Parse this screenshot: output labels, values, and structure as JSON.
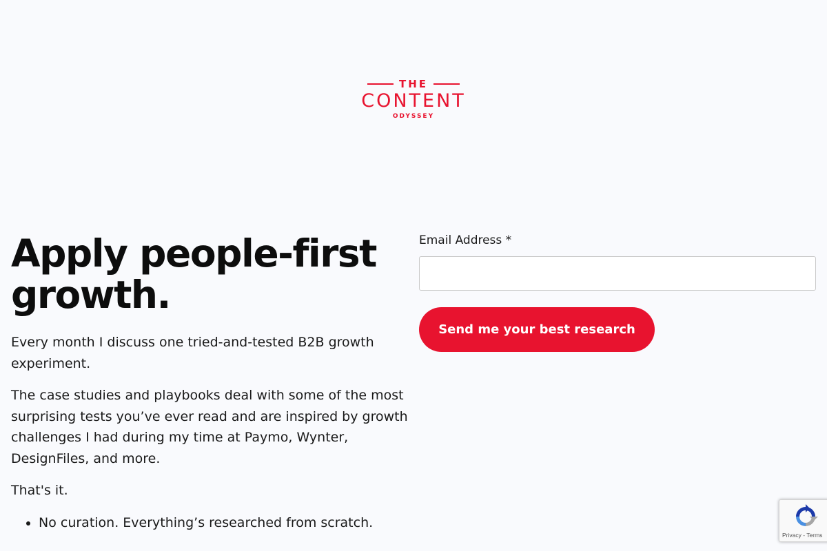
{
  "logo": {
    "the": "THE",
    "main": "CONTENT",
    "sub": "ODYSSEY",
    "color": "#e8132f"
  },
  "hero": {
    "headline": "Apply people-first growth.",
    "paragraphs": [
      "Every month I discuss one tried-and-tested B2B growth experiment.",
      "The case studies and playbooks deal with some of the most surprising tests you’ve ever read and are inspired by growth challenges I had during my time at Paymo, Wynter, DesignFiles, and more.",
      "That's it."
    ],
    "bullets": [
      "No curation. Everything’s researched from scratch."
    ]
  },
  "form": {
    "email_label": "Email Address *",
    "email_value": "",
    "email_placeholder": "",
    "submit_label": "Send me your best research",
    "accent": "#e8132f"
  },
  "recaptcha": {
    "links": "Privacy - Terms",
    "icon": "recaptcha-icon"
  }
}
